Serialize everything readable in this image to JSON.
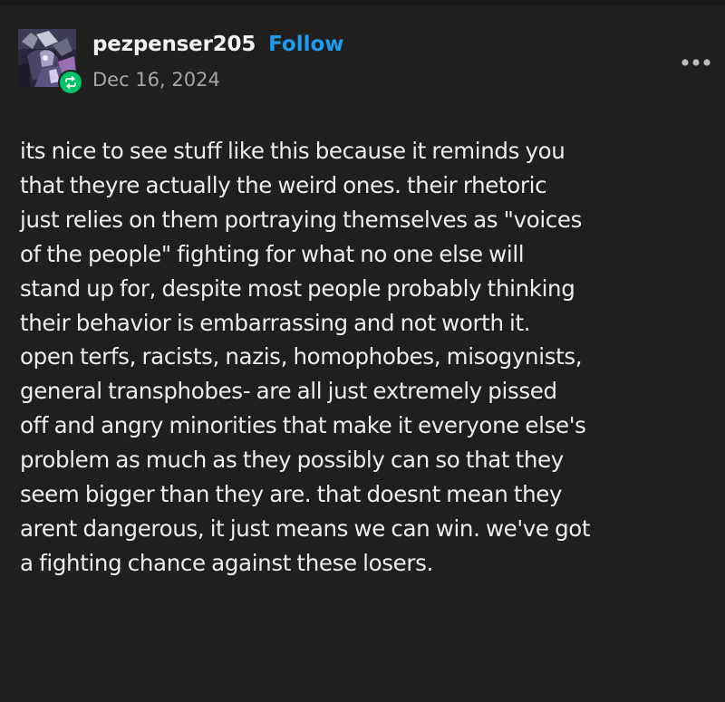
{
  "post": {
    "username": "pezpenser205",
    "follow_label": "Follow",
    "date": "Dec 16, 2024",
    "more_icon": "more-horizontal-icon",
    "reblog_icon": "reblog-icon",
    "accent_color": "#1f9bf0",
    "badge_color": "#00c46a",
    "body_lines": [
      "its nice to see stuff like this because it reminds you",
      "that theyre actually the weird ones. their rhetoric",
      "just relies on them portraying themselves as \"voices",
      "of the people\" fighting for what no one else will",
      "stand up for, despite most people probably thinking",
      "their behavior is embarrassing and not worth it.",
      "open terfs, racists, nazis, homophobes, misogynists,",
      "general transphobes- are all just extremely pissed",
      "off and angry minorities that make it everyone else's",
      "problem as much as they possibly can so that they",
      "seem bigger than they are. that doesnt mean they",
      "arent dangerous, it just means we can win. we've got",
      "a fighting chance against these losers."
    ]
  }
}
